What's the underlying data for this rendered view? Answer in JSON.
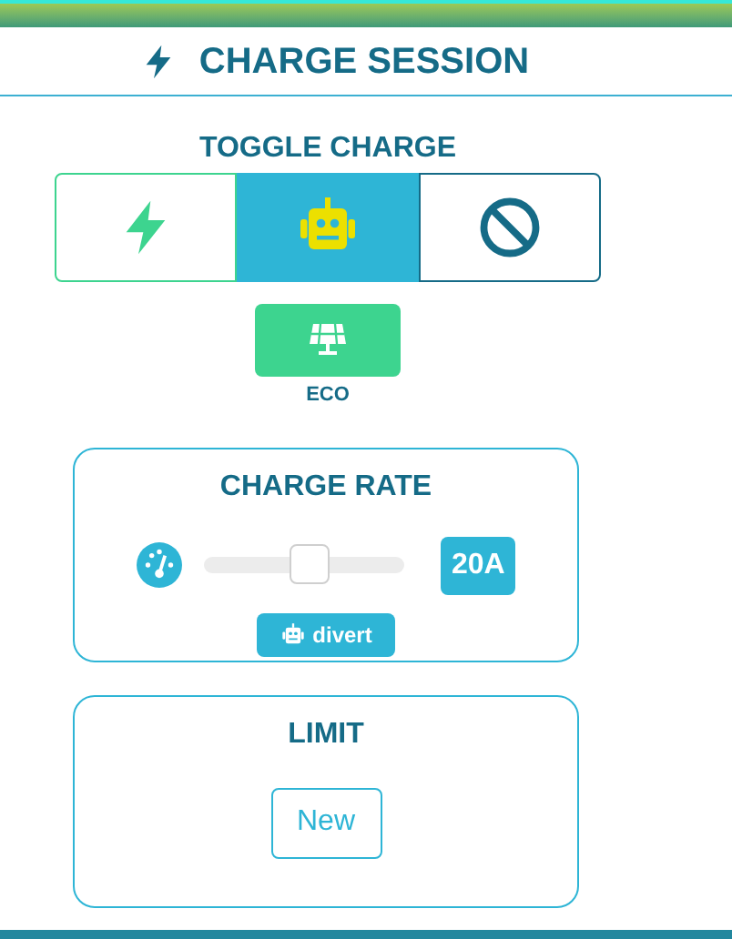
{
  "header": {
    "title": "CHARGE SESSION"
  },
  "toggle": {
    "title": "TOGGLE CHARGE",
    "modes": [
      {
        "kind": "bolt",
        "selected": false
      },
      {
        "kind": "robot",
        "selected": true
      },
      {
        "kind": "stop",
        "selected": false
      }
    ]
  },
  "eco": {
    "label": "ECO"
  },
  "charge_rate": {
    "title": "CHARGE RATE",
    "level": 0.53,
    "reading": "20A",
    "divert": "divert"
  },
  "limit": {
    "title": "LIMIT",
    "button": "New"
  }
}
